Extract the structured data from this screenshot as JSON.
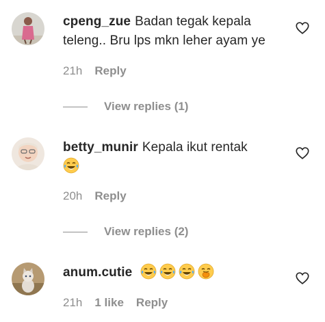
{
  "comments": [
    {
      "username": "cpeng_zue",
      "text": "Badan tegak kepala teleng.. Bru lps mkn leher ayam ye",
      "time": "21h",
      "reply_label": "Reply",
      "view_replies": "View replies (1)",
      "liked": false
    },
    {
      "username": "betty_munir",
      "text": "Kepala ikut rentak",
      "emojis": [
        "laughing-tears"
      ],
      "time": "20h",
      "reply_label": "Reply",
      "view_replies": "View replies (2)",
      "liked": false
    },
    {
      "username": "anum.cutie",
      "text": "",
      "emojis": [
        "laughing-tears",
        "laughing-tears",
        "laughing-tears",
        "hand-over-mouth"
      ],
      "time": "21h",
      "likes": "1 like",
      "reply_label": "Reply",
      "liked": false
    }
  ],
  "colors": {
    "text": "#262626",
    "secondary": "#8e8e8e",
    "emoji_face": "#ffcc4d"
  }
}
